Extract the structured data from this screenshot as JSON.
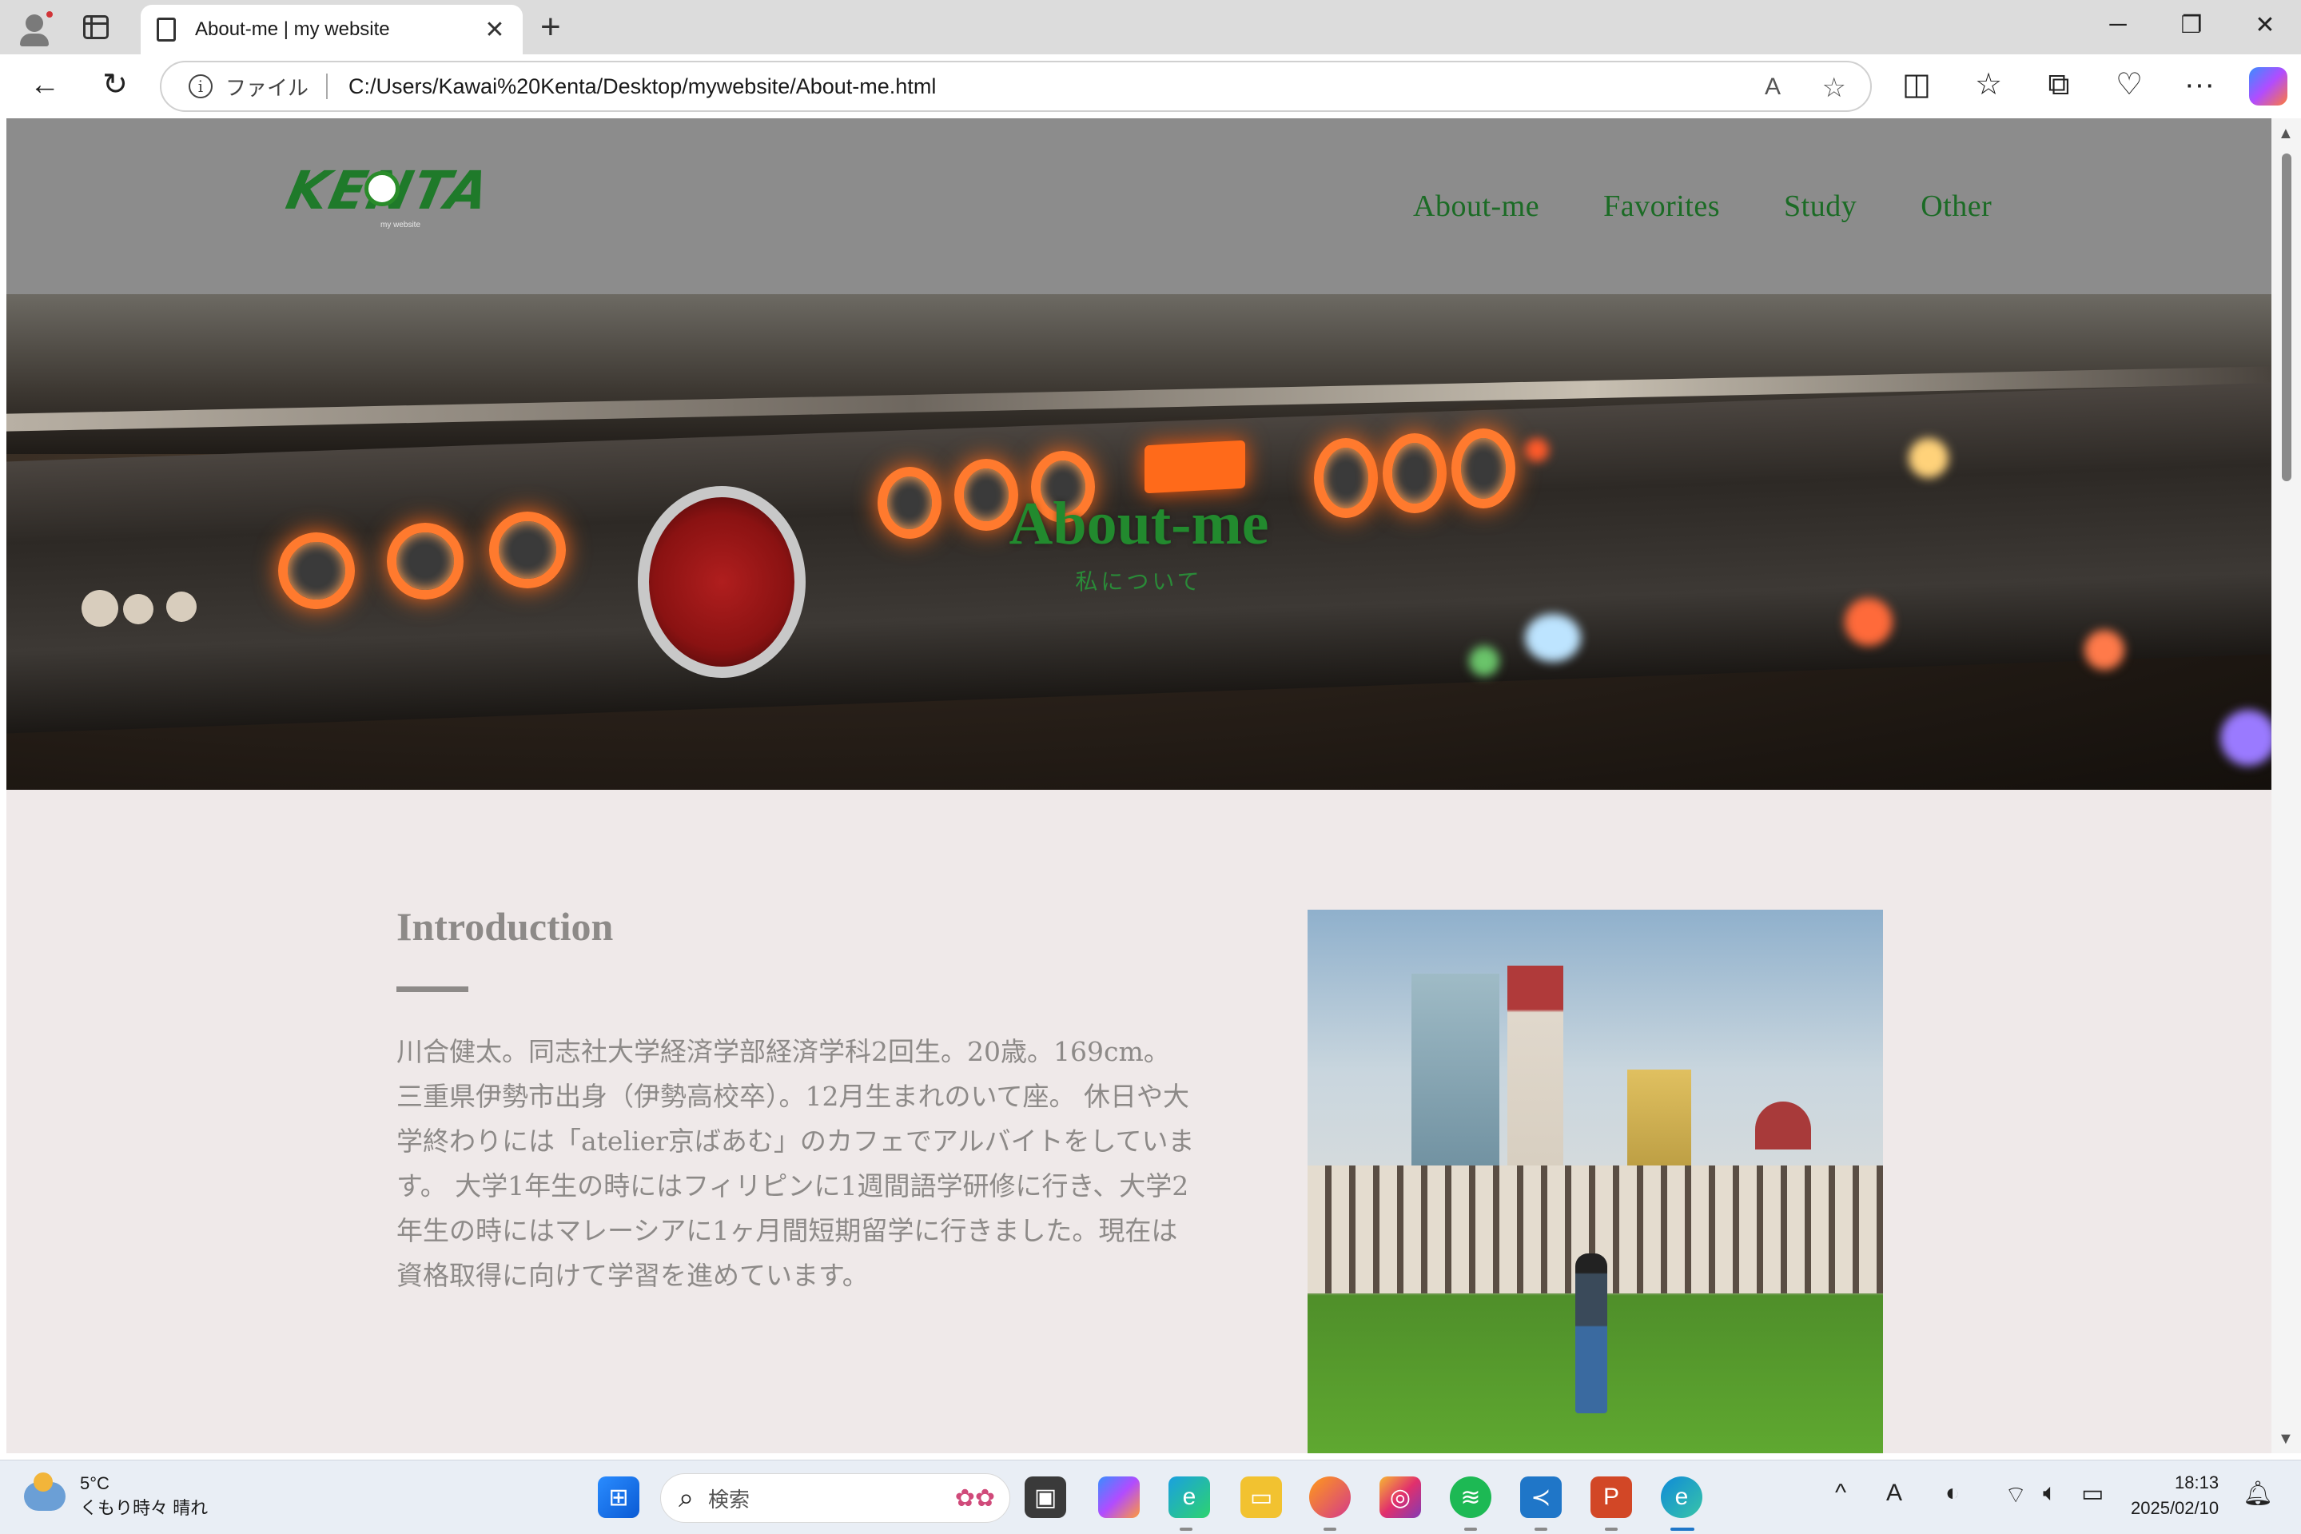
{
  "browser": {
    "tab_title": "About-me | my website",
    "address_scheme": "ファイル",
    "address_url": "C:/Users/Kawai%20Kenta/Desktop/mywebsite/About-me.html",
    "read_aloud_label": "A̅",
    "new_tab_symbol": "+",
    "close_tab_symbol": "✕",
    "window": {
      "minimize": "─",
      "restore": "❐",
      "close": "✕"
    },
    "toolbar": {
      "back": "←",
      "refresh": "↻",
      "split": "◫",
      "favorites": "☆",
      "collections": "⧉",
      "health": "♡",
      "more": "···"
    }
  },
  "site": {
    "logo_text": "KENTA",
    "logo_tagline": "my website",
    "nav": [
      "About-me",
      "Favorites",
      "Study",
      "Other"
    ],
    "hero_title": "About-me",
    "hero_subtitle": "私について",
    "intro": {
      "heading": "Introduction",
      "body": "川合健太。同志社大学経済学部経済学科2回生。20歳。169cm。三重県伊勢市出身（伊勢高校卒）。12月生まれのいて座。 休日や大学終わりには「atelier京ばあむ」のカフェでアルバイトをしています。 大学1年生の時にはフィリピンに1週間語学研修に行き、大学2年生の時にはマレーシアに1ヶ月間短期留学に行きました。現在は資格取得に向けて学習を進めています。"
    },
    "colors": {
      "header_bg": "#8c8c8c",
      "nav_text": "#1b6b25",
      "page_bg": "#efe9e9",
      "body_text": "#8d8a88"
    }
  },
  "taskbar": {
    "weather_temp": "5°C",
    "weather_desc": "くもり時々 晴れ",
    "search_placeholder": "検索",
    "time": "18:13",
    "date": "2025/02/10",
    "ime_label": "A"
  }
}
